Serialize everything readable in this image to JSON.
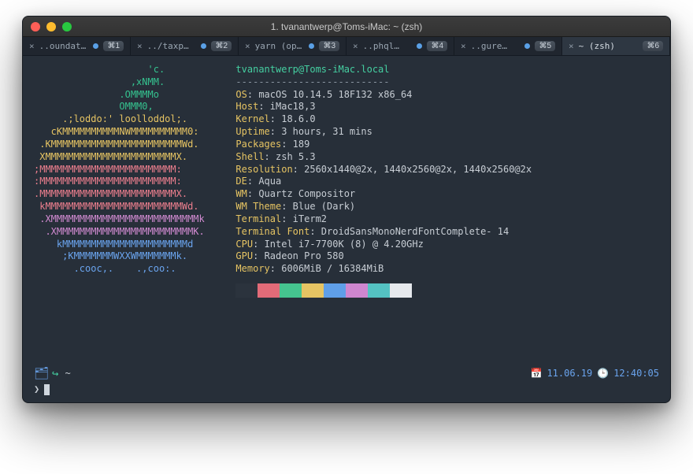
{
  "window": {
    "title": "1. tvanantwerp@Toms-iMac: ~ (zsh)"
  },
  "tabs": [
    {
      "label": "..oundatio…",
      "dot": true,
      "key": "⌘1",
      "active": false
    },
    {
      "label": "../taxp…",
      "dot": true,
      "key": "⌘2",
      "active": false
    },
    {
      "label": "yarn (ope…",
      "dot": true,
      "key": "⌘3",
      "active": false
    },
    {
      "label": "..phql…",
      "dot": true,
      "key": "⌘4",
      "active": false
    },
    {
      "label": "..gure…",
      "dot": true,
      "key": "⌘5",
      "active": false
    },
    {
      "label": "~ (zsh)",
      "dot": false,
      "key": "⌘6",
      "active": true
    }
  ],
  "neofetch": {
    "title": "tvanantwerp@Toms-iMac.local",
    "sep": "---------------------------",
    "rows": [
      {
        "k": "OS",
        "v": "macOS 10.14.5 18F132 x86_64"
      },
      {
        "k": "Host",
        "v": "iMac18,3"
      },
      {
        "k": "Kernel",
        "v": "18.6.0"
      },
      {
        "k": "Uptime",
        "v": "3 hours, 31 mins"
      },
      {
        "k": "Packages",
        "v": "189"
      },
      {
        "k": "Shell",
        "v": "zsh 5.3"
      },
      {
        "k": "Resolution",
        "v": "2560x1440@2x, 1440x2560@2x, 1440x2560@2x"
      },
      {
        "k": "DE",
        "v": "Aqua"
      },
      {
        "k": "WM",
        "v": "Quartz Compositor"
      },
      {
        "k": "WM Theme",
        "v": "Blue (Dark)"
      },
      {
        "k": "Terminal",
        "v": "iTerm2"
      },
      {
        "k": "Terminal Font",
        "v": "DroidSansMonoNerdFontComplete- 14"
      },
      {
        "k": "CPU",
        "v": "Intel i7-7700K (8) @ 4.20GHz"
      },
      {
        "k": "GPU",
        "v": "Radeon Pro 580"
      },
      {
        "k": "Memory",
        "v": "6006MiB / 16384MiB"
      }
    ],
    "logo_lines": [
      {
        "c": "g",
        "t": "                    'c.          "
      },
      {
        "c": "g",
        "t": "                 ,xNMM.          "
      },
      {
        "c": "g",
        "t": "               .OMMMMo           "
      },
      {
        "c": "g",
        "t": "               OMMM0,            "
      },
      {
        "c": "y",
        "t": "     .;loddo:' loolloddol;.      "
      },
      {
        "c": "y",
        "t": "   cKMMMMMMMMMMNWMMMMMMMMMM0:    "
      },
      {
        "c": "y",
        "t": " .KMMMMMMMMMMMMMMMMMMMMMMMWd.    "
      },
      {
        "c": "y",
        "t": " XMMMMMMMMMMMMMMMMMMMMMMMX.      "
      },
      {
        "c": "r",
        "t": ";MMMMMMMMMMMMMMMMMMMMMMMM:       "
      },
      {
        "c": "r",
        "t": ":MMMMMMMMMMMMMMMMMMMMMMMM:       "
      },
      {
        "c": "r",
        "t": ".MMMMMMMMMMMMMMMMMMMMMMMMX.      "
      },
      {
        "c": "r",
        "t": " kMMMMMMMMMMMMMMMMMMMMMMMMWd.    "
      },
      {
        "c": "p",
        "t": " .XMMMMMMMMMMMMMMMMMMMMMMMMMMk   "
      },
      {
        "c": "p",
        "t": "  .XMMMMMMMMMMMMMMMMMMMMMMMMK.   "
      },
      {
        "c": "b",
        "t": "    kMMMMMMMMMMMMMMMMMMMMMMd     "
      },
      {
        "c": "b",
        "t": "     ;KMMMMMMMWXXWMMMMMMMk.      "
      },
      {
        "c": "b",
        "t": "       .cooc,.    .,coo:.        "
      }
    ],
    "swatches": [
      "#2b333d",
      "#e26b78",
      "#45c48f",
      "#e6c463",
      "#5f9fe8",
      "#cf86cf",
      "#54c2c2",
      "#e6e9ed"
    ]
  },
  "status": {
    "path": "~",
    "date": "11.06.19",
    "time": "12:40:05"
  },
  "prompt": {
    "caret": "❯"
  }
}
